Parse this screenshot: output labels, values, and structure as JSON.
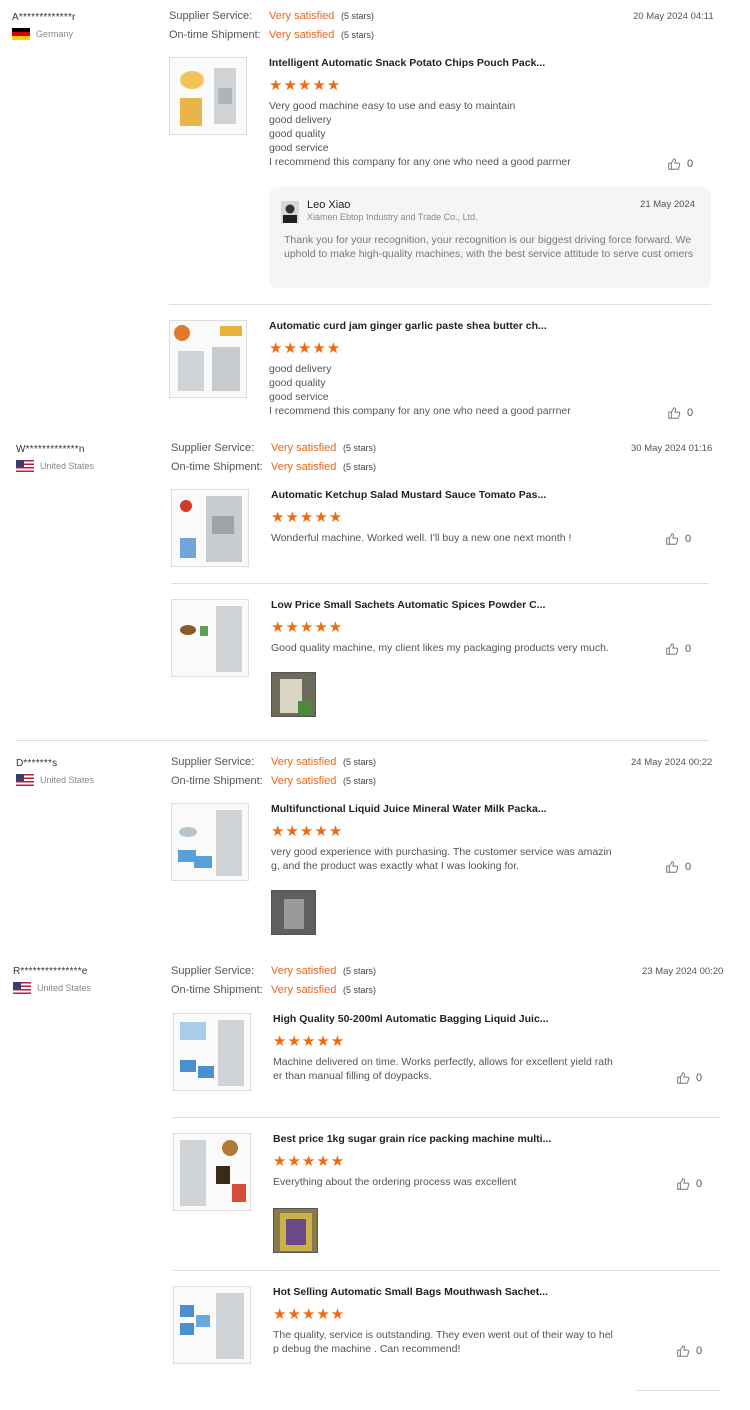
{
  "labels": {
    "supplier_service": "Supplier Service:",
    "ontime_shipment": "On-time Shipment:",
    "rating_value": "Very satisfied",
    "rating_stars": "(5 stars)"
  },
  "colors": {
    "accent": "#e8671d",
    "star": "#f06a0f"
  },
  "reviews": [
    {
      "reviewer": "A*************r",
      "country": "Germany",
      "date": "20 May 2024 04:11",
      "items": [
        {
          "title": "Intelligent Automatic Snack Potato Chips Pouch Pack...",
          "stars": "★★★★★",
          "comment": "Very good machine easy to use and easy to maintain\ngood delivery\ngood quality\ngood service\nI recommend this company for any one who need a good parrner",
          "likes": "0"
        },
        {
          "title": "Automatic curd jam ginger garlic paste shea butter ch...",
          "stars": "★★★★★",
          "comment": "good delivery\ngood quality\ngood service\nI recommend this company for any one who need a good parrner",
          "likes": "0"
        }
      ],
      "reply": {
        "name": "Leo Xiao",
        "company": "Xiamen Ebtop Industry and Trade Co., Ltd.",
        "date": "21 May 2024",
        "text": "Thank you for your recognition, your recognition is our biggest driving force forward. We uphold to make high-quality machines, with the best service attitude to serve cust omers"
      }
    },
    {
      "reviewer": "W*************n",
      "country": "United States",
      "date": "30 May 2024 01:16",
      "items": [
        {
          "title": "Automatic Ketchup Salad Mustard Sauce Tomato Pas...",
          "stars": "★★★★★",
          "comment": "Wonderful machine. Worked well. I'll buy a new one next month !",
          "likes": "0"
        },
        {
          "title": "Low Price Small Sachets Automatic Spices Powder C...",
          "stars": "★★★★★",
          "comment": "Good quality machine, my client likes my packaging products very much.",
          "likes": "0"
        }
      ]
    },
    {
      "reviewer": "D*******s",
      "country": "United States",
      "date": "24 May 2024 00:22",
      "items": [
        {
          "title": "Multifunctional Liquid Juice Mineral Water Milk Packa...",
          "stars": "★★★★★",
          "comment": "very good experience with purchasing. The customer service was amazin\ng, and the product was exactly what I was looking for.",
          "likes": "0"
        }
      ]
    },
    {
      "reviewer": "R***************e",
      "country": "United States",
      "date": "23 May 2024 00:20",
      "items": [
        {
          "title": "High Quality 50-200ml Automatic Bagging Liquid Juic...",
          "stars": "★★★★★",
          "comment": "Machine delivered on time. Works perfectly, allows for excellent yield rath\ner than manual filling of doypacks.",
          "likes": "0"
        },
        {
          "title": "Best price 1kg sugar grain rice packing machine multi...",
          "stars": "★★★★★",
          "comment": "Everything about the ordering process was excellent",
          "likes": "0"
        },
        {
          "title": "Hot Selling Automatic Small Bags Mouthwash Sachet...",
          "stars": "★★★★★",
          "comment": "The quality, service is outstanding. They even went out of their way to hel\np debug the machine . Can recommend!",
          "likes": "0"
        }
      ]
    }
  ]
}
